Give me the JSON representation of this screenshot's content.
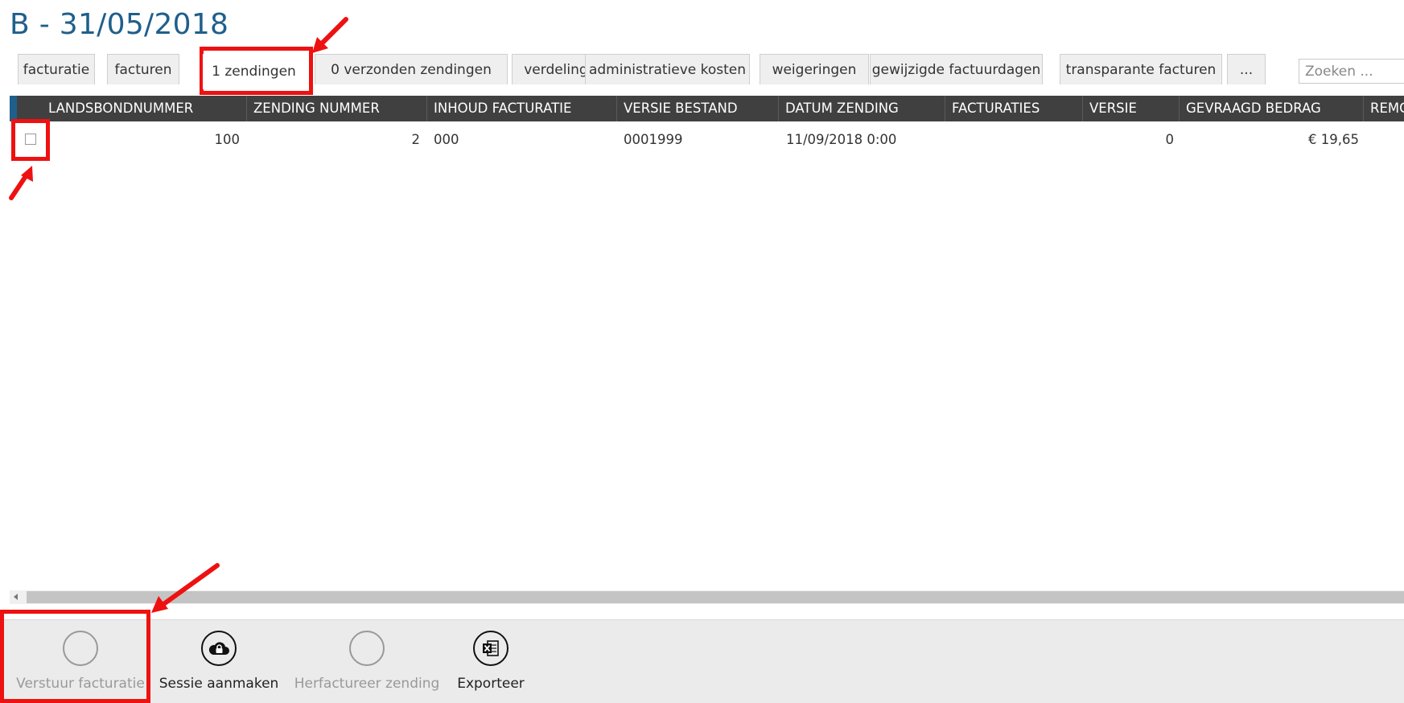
{
  "page": {
    "title": "B - 31/05/2018"
  },
  "tabs": [
    {
      "label": "facturatie"
    },
    {
      "label": "facturen"
    },
    {
      "label": "1 zendingen",
      "active": true
    },
    {
      "label": "0 verzonden zendingen"
    },
    {
      "label": "verdeling"
    },
    {
      "label": "administratieve kosten"
    },
    {
      "label": "weigeringen"
    },
    {
      "label": "gewijzigde factuurdagen"
    },
    {
      "label": "transparante facturen"
    },
    {
      "label": "..."
    }
  ],
  "search": {
    "placeholder": "Zoeken ...",
    "value": ""
  },
  "grid": {
    "columns": [
      "LANDSBONDNUMMER",
      "ZENDING NUMMER",
      "INHOUD FACTURATIE",
      "VERSIE BESTAND",
      "DATUM ZENDING",
      "FACTURATIES",
      "VERSIE",
      "GEVRAAGD BEDRAG",
      "REMGELD"
    ],
    "rows": [
      {
        "checked": false,
        "landsbondnummer": "100",
        "zending_nummer": "2",
        "inhoud_facturatie": "000",
        "versie_bestand": "0001999",
        "datum_zending": "11/09/2018 0:00",
        "facturaties": "",
        "versie": "0",
        "gevraagd_bedrag": "€ 19,65"
      }
    ]
  },
  "toolbar": {
    "buttons": [
      {
        "label": "Verstuur facturatie",
        "enabled": false,
        "icon": "empty-circle-icon"
      },
      {
        "label": "Sessie aanmaken",
        "enabled": true,
        "icon": "cloud-lock-icon"
      },
      {
        "label": "Herfactureer zending",
        "enabled": false,
        "icon": "empty-circle-icon"
      },
      {
        "label": "Exporteer",
        "enabled": true,
        "icon": "excel-export-icon"
      }
    ]
  },
  "colors": {
    "title": "#1f5f8b",
    "header_bg": "#404040",
    "accent": "#1f5f8b",
    "highlight": "#ee1111",
    "toolbar_bg": "#ebebeb"
  }
}
